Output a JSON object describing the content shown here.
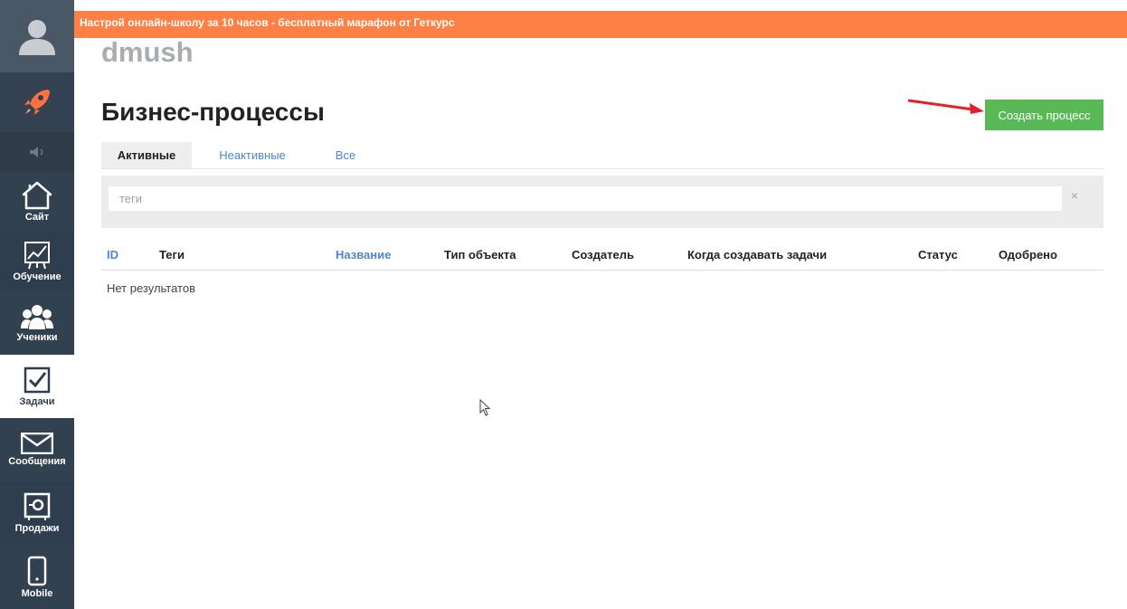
{
  "banner": {
    "text": "Настрой онлайн-школу за 10 часов - бесплатный марафон от Геткурс"
  },
  "school_name": "dmush",
  "page_title": "Бизнес-процессы",
  "create_button": "Создать процесс",
  "sidebar": {
    "items": [
      {
        "id": "site",
        "label": "Сайт",
        "icon": "house-icon"
      },
      {
        "id": "learning",
        "label": "Обучение",
        "icon": "chart-board-icon"
      },
      {
        "id": "students",
        "label": "Ученики",
        "icon": "people-icon"
      },
      {
        "id": "tasks",
        "label": "Задачи",
        "icon": "checkbox-icon",
        "active": true
      },
      {
        "id": "messages",
        "label": "Сообщения",
        "icon": "envelope-icon"
      },
      {
        "id": "sales",
        "label": "Продажи",
        "icon": "safe-icon"
      },
      {
        "id": "mobile",
        "label": "Mobile",
        "icon": "phone-icon"
      }
    ]
  },
  "tabs": [
    {
      "label": "Активные",
      "active": true
    },
    {
      "label": "Неактивные",
      "active": false
    },
    {
      "label": "Все",
      "active": false
    }
  ],
  "filter": {
    "placeholder": "теги",
    "clear": "×"
  },
  "table": {
    "columns": [
      {
        "label": "ID",
        "sortable": true
      },
      {
        "label": "Теги",
        "sortable": false
      },
      {
        "label": "Название",
        "sortable": true
      },
      {
        "label": "Тип объекта",
        "sortable": false
      },
      {
        "label": "Создатель",
        "sortable": false
      },
      {
        "label": "Когда создавать задачи",
        "sortable": false
      },
      {
        "label": "Статус",
        "sortable": false
      },
      {
        "label": "Одобрено",
        "sortable": false
      }
    ],
    "empty_message": "Нет результатов"
  },
  "colors": {
    "banner": "#ff8044",
    "sidebar": "#2f3e4f",
    "create_button": "#58b956",
    "link": "#4f86c6",
    "arrow": "#e3212b"
  }
}
